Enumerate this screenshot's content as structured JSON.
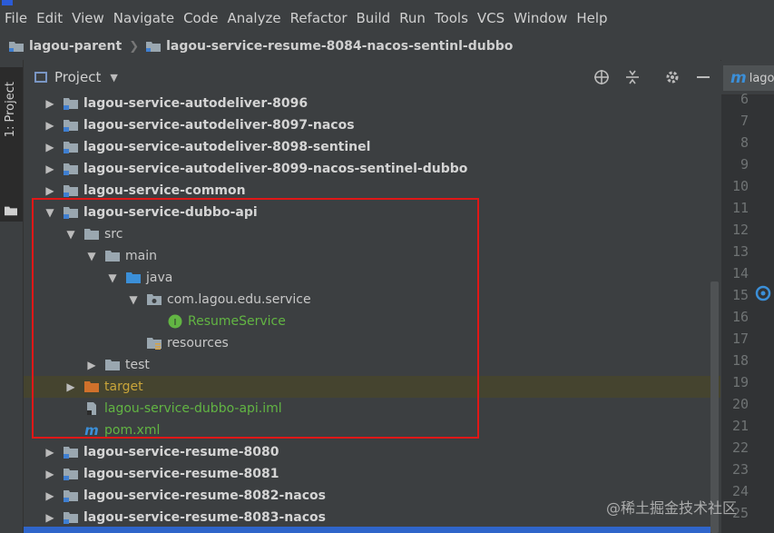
{
  "menu": [
    "File",
    "Edit",
    "View",
    "Navigate",
    "Code",
    "Analyze",
    "Refactor",
    "Build",
    "Run",
    "Tools",
    "VCS",
    "Window",
    "Help"
  ],
  "breadcrumb": [
    "lagou-parent",
    "lagou-service-resume-8084-nacos-sentinl-dubbo"
  ],
  "sidebar": {
    "tab_label": "1: Project"
  },
  "panel": {
    "title": "Project"
  },
  "tree": [
    {
      "label": "lagou-service-autodeliver-8096",
      "arrow": "collapsed",
      "icon": "module-folder-icon",
      "style": "bold"
    },
    {
      "label": "lagou-service-autodeliver-8097-nacos",
      "arrow": "collapsed",
      "icon": "module-folder-icon",
      "style": "bold"
    },
    {
      "label": "lagou-service-autodeliver-8098-sentinel",
      "arrow": "collapsed",
      "icon": "module-folder-icon",
      "style": "bold"
    },
    {
      "label": "lagou-service-autodeliver-8099-nacos-sentinel-dubbo",
      "arrow": "collapsed",
      "icon": "module-folder-icon",
      "style": "bold"
    },
    {
      "label": "lagou-service-common",
      "arrow": "collapsed",
      "icon": "module-folder-icon",
      "style": "bold"
    },
    {
      "label": "lagou-service-dubbo-api",
      "arrow": "expanded",
      "icon": "module-folder-icon",
      "style": "bold"
    },
    {
      "label": "src",
      "arrow": "expanded",
      "icon": "folder-icon",
      "style": "normal"
    },
    {
      "label": "main",
      "arrow": "expanded",
      "icon": "folder-icon",
      "style": "normal"
    },
    {
      "label": "java",
      "arrow": "expanded",
      "icon": "source-folder-icon",
      "style": "normal"
    },
    {
      "label": "com.lagou.edu.service",
      "arrow": "expanded",
      "icon": "package-icon",
      "style": "normal"
    },
    {
      "label": "ResumeService",
      "arrow": "none",
      "icon": "interface-icon",
      "style": "green"
    },
    {
      "label": "resources",
      "arrow": "none",
      "icon": "resources-folder-icon",
      "style": "normal"
    },
    {
      "label": "test",
      "arrow": "collapsed",
      "icon": "folder-icon",
      "style": "normal"
    },
    {
      "label": "target",
      "arrow": "collapsed",
      "icon": "excluded-folder-icon",
      "style": "orange",
      "highlight": true
    },
    {
      "label": "lagou-service-dubbo-api.iml",
      "arrow": "none",
      "icon": "iml-file-icon",
      "style": "green"
    },
    {
      "label": "pom.xml",
      "arrow": "none",
      "icon": "maven-icon",
      "style": "green"
    },
    {
      "label": "lagou-service-resume-8080",
      "arrow": "collapsed",
      "icon": "module-folder-icon",
      "style": "bold"
    },
    {
      "label": "lagou-service-resume-8081",
      "arrow": "collapsed",
      "icon": "module-folder-icon",
      "style": "bold"
    },
    {
      "label": "lagou-service-resume-8082-nacos",
      "arrow": "collapsed",
      "icon": "module-folder-icon",
      "style": "bold"
    },
    {
      "label": "lagou-service-resume-8083-nacos",
      "arrow": "collapsed",
      "icon": "module-folder-icon",
      "style": "bold"
    }
  ],
  "editor": {
    "tab_glyph": "m",
    "tab_label": "lago",
    "line_numbers": [
      "6",
      "7",
      "8",
      "9",
      "10",
      "11",
      "12",
      "13",
      "14",
      "15",
      "16",
      "17",
      "18",
      "19",
      "20",
      "21",
      "22",
      "23",
      "24",
      "25"
    ]
  },
  "watermark": "@稀土掘金技术社区",
  "colors": {
    "accent": "#2f65ca",
    "green": "#62b543",
    "orange": "#c9a53a",
    "annotation_box": "#e01717"
  }
}
